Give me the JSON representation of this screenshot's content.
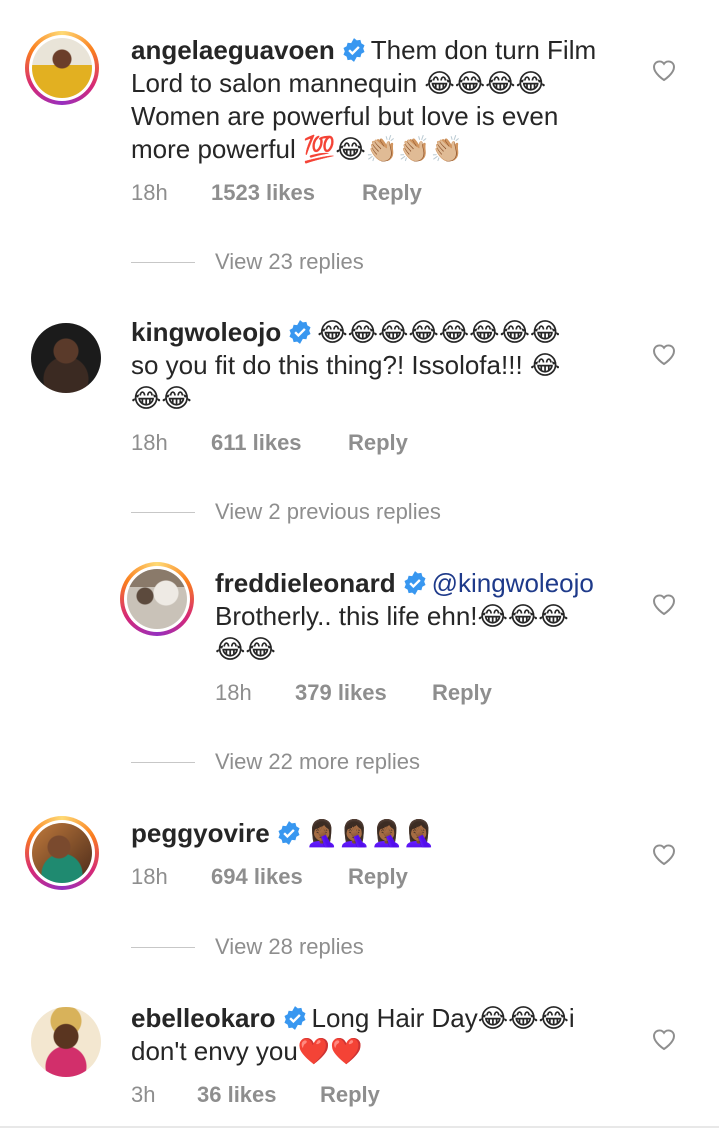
{
  "comments": [
    {
      "username": "angelaeguavoen",
      "text_lines": [
        "Them don turn Film",
        "Lord to salon mannequin 😂😂😂😂",
        "Women are powerful but love is even",
        "more powerful 💯😂👏🏼👏🏼👏🏼"
      ],
      "time": "18h",
      "likes": "1523 likes",
      "reply": "Reply"
    },
    {
      "username": "kingwoleojo",
      "text_lines": [
        "😂😂😂😂😂😂😂😂",
        "so you fit do this thing?! Issolofa!!! 😂",
        "😂😂"
      ],
      "time": "18h",
      "likes": "611 likes",
      "reply": "Reply"
    },
    {
      "username": "freddieleonard",
      "mention": "@kingwoleojo",
      "text_lines": [
        "Brotherly.. this life ehn!😂😂😂",
        "😂😂"
      ],
      "time": "18h",
      "likes": "379 likes",
      "reply": "Reply"
    },
    {
      "username": "peggyovire",
      "text_lines": [
        "🤦🏾‍♀️🤦🏾‍♀️🤦🏾‍♀️🤦🏾‍♀️"
      ],
      "time": "18h",
      "likes": "694 likes",
      "reply": "Reply"
    },
    {
      "username": "ebelleokaro",
      "text_lines": [
        "Long Hair Day😂😂😂i",
        "don't envy you❤️❤️"
      ],
      "time": "3h",
      "likes": "36 likes",
      "reply": "Reply"
    }
  ],
  "view_replies": [
    "View 23 replies",
    "View 2 previous replies",
    "View 22 more replies",
    "View 28 replies"
  ],
  "colors": {
    "verified": "#3897f0",
    "muted": "#8e8e8e",
    "mention": "#1e3a8a"
  },
  "icons": [
    "verified-badge-icon",
    "heart-outline-icon"
  ]
}
